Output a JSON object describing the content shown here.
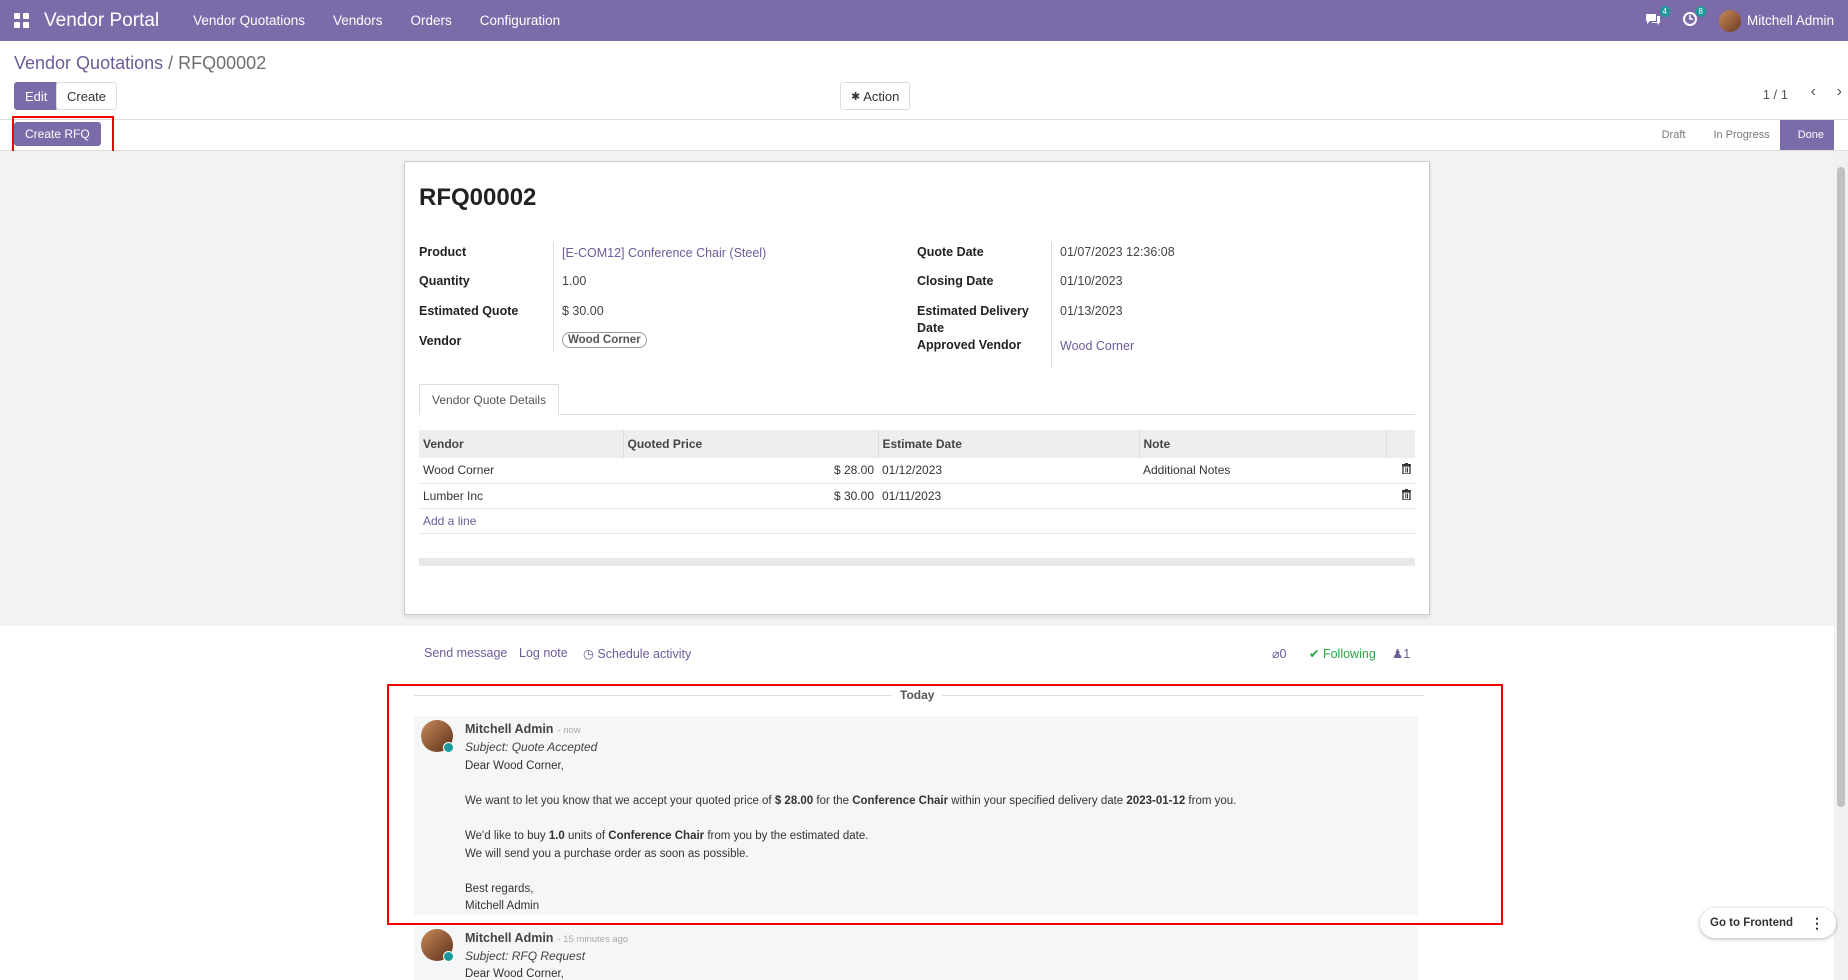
{
  "topbar": {
    "brand": "Vendor Portal",
    "menu": [
      "Vendor Quotations",
      "Vendors",
      "Orders",
      "Configuration"
    ],
    "messages_count": "4",
    "activities_count": "8",
    "user_name": "Mitchell Admin"
  },
  "breadcrumb": {
    "parent": "Vendor Quotations",
    "separator": "/",
    "current": "RFQ00002"
  },
  "buttons": {
    "edit": "Edit",
    "create": "Create",
    "action": "Action",
    "create_rfq": "Create RFQ"
  },
  "pager": {
    "value": "1 / 1"
  },
  "stages": [
    "Draft",
    "In Progress",
    "Done"
  ],
  "record": {
    "name": "RFQ00002",
    "product_label": "Product",
    "product": "[E-COM12] Conference Chair (Steel)",
    "quantity_label": "Quantity",
    "quantity": "1.00",
    "estimated_quote_label": "Estimated Quote",
    "estimated_quote": "$ 30.00",
    "vendor_label": "Vendor",
    "vendor": "Wood Corner",
    "quote_date_label": "Quote Date",
    "quote_date": "01/07/2023 12:36:08",
    "closing_date_label": "Closing Date",
    "closing_date": "01/10/2023",
    "est_delivery_label_1": "Estimated Delivery",
    "est_delivery_label_2": "Date",
    "est_delivery": "01/13/2023",
    "approved_vendor_label": "Approved Vendor",
    "approved_vendor": "Wood Corner"
  },
  "tab": {
    "label": "Vendor Quote Details"
  },
  "lines": {
    "headers": [
      "Vendor",
      "Quoted Price",
      "Estimate Date",
      "Note"
    ],
    "rows": [
      {
        "vendor": "Wood Corner",
        "price": "$ 28.00",
        "date": "01/12/2023",
        "note": "Additional Notes"
      },
      {
        "vendor": "Lumber Inc",
        "price": "$ 30.00",
        "date": "01/11/2023",
        "note": ""
      }
    ],
    "add_line": "Add a line"
  },
  "chatter": {
    "send_message": "Send message",
    "log_note": "Log note",
    "schedule_activity": "Schedule activity",
    "attachments": "0",
    "following": "Following",
    "followers": "1",
    "today": "Today",
    "msg1": {
      "author": "Mitchell Admin",
      "time": "- now",
      "subject": "Subject: Quote Accepted",
      "greeting": "Dear Wood Corner,",
      "p1a": "We want to let you know that we accept your quoted price of ",
      "p1b": "$ 28.00",
      "p1c": " for the ",
      "p1d": "Conference Chair",
      "p1e": " within your specified delivery date ",
      "p1f": "2023-01-12",
      "p1g": " from you.",
      "p2a": "We'd like to buy ",
      "p2b": "1.0",
      "p2c": " units of ",
      "p2d": "Conference Chair",
      "p2e": " from you by the estimated date.",
      "p3": "We will send you a purchase order as soon as possible.",
      "closing": "Best regards,",
      "signature": "Mitchell Admin"
    },
    "msg2": {
      "author": "Mitchell Admin",
      "time": "- 15 minutes ago",
      "subject": "Subject: RFQ Request",
      "greeting": "Dear Wood Corner,"
    }
  },
  "go_frontend": "Go to Frontend"
}
